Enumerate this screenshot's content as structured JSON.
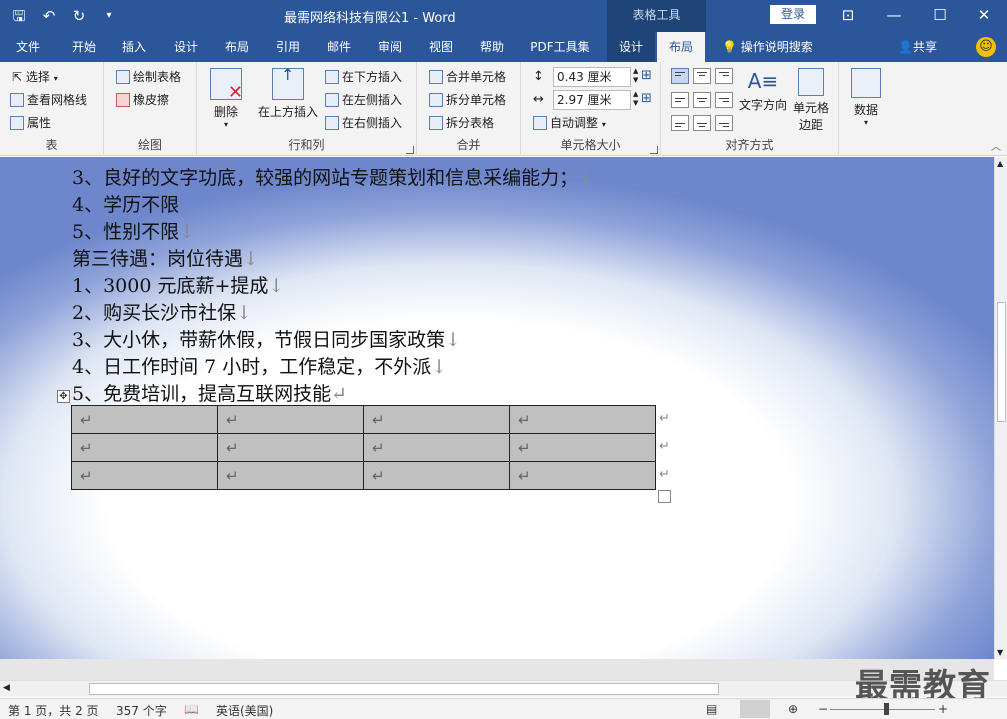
{
  "titlebar": {
    "title": "最需网络科技有限公1  -  Word",
    "context_tab_title": "表格工具",
    "login": "登录",
    "icons": [
      "save-icon",
      "undo-icon",
      "redo-icon",
      "customize-qat-icon"
    ]
  },
  "tabs": [
    "文件",
    "开始",
    "插入",
    "设计",
    "布局",
    "引用",
    "邮件",
    "审阅",
    "视图",
    "帮助",
    "PDF工具集",
    "设计",
    "布局"
  ],
  "tell_me": "操作说明搜索",
  "share": "共享",
  "ribbon": {
    "table": {
      "select": "选择",
      "view_gridlines": "查看网格线",
      "properties": "属性",
      "label": "表"
    },
    "draw": {
      "draw_table": "绘制表格",
      "eraser": "橡皮擦",
      "label": "绘图"
    },
    "rows_cols": {
      "delete": "删除",
      "insert_above": "在上方插入",
      "insert_below": "在下方插入",
      "insert_left": "在左侧插入",
      "insert_right": "在右侧插入",
      "label": "行和列"
    },
    "merge": {
      "merge_cells": "合并单元格",
      "split_cells": "拆分单元格",
      "split_table": "拆分表格",
      "label": "合并"
    },
    "cell_size": {
      "height": "0.43 厘米",
      "width": "2.97 厘米",
      "autofit": "自动调整",
      "label": "单元格大小"
    },
    "alignment": {
      "text_direction": "文字方向",
      "cell_margins_1": "单元格",
      "cell_margins_2": "边距",
      "label": "对齐方式"
    },
    "data": {
      "label": "数据"
    }
  },
  "document": {
    "lines": [
      {
        "text": "3、良好的文字功底，较强的网站专题策划和信息采编能力；",
        "mark": "↓"
      },
      {
        "text": "4、学历不限",
        "mark": ""
      },
      {
        "text": "5、性别不限",
        "mark": "↓"
      },
      {
        "text": "第三待遇：岗位待遇",
        "mark": "↓"
      },
      {
        "text": "1、3000 元底薪+提成",
        "mark": "↓"
      },
      {
        "text": "2、购买长沙市社保",
        "mark": "↓"
      },
      {
        "text": "3、大小休，带薪休假，节假日同步国家政策",
        "mark": "↓"
      },
      {
        "text": "4、日工作时间 7 小时，工作稳定，不外派",
        "mark": "↓"
      },
      {
        "text": "5、免费培训，提高互联网技能",
        "mark": "↵"
      }
    ],
    "table_cell_mark": "↵",
    "table_row_end_mark": "↵"
  },
  "statusbar": {
    "page": "第 1 页，共 2 页",
    "words": "357 个字",
    "language": "英语(美国)",
    "zoom": "130%"
  },
  "watermark": "最需教育",
  "colors": {
    "brand": "#2b579a",
    "context_tab": "#1e4478",
    "table_shading": "#c0c0c0"
  }
}
